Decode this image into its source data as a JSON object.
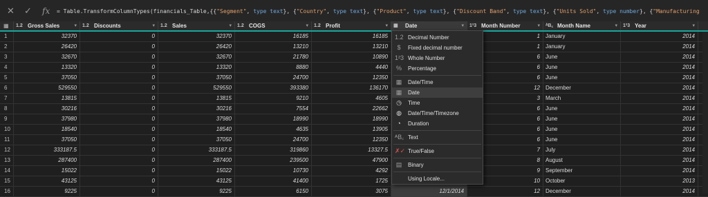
{
  "formula_bar": {
    "formula_segments": [
      {
        "t": "= Table.TransformColumnTypes(financials_Table,{{",
        "c": ""
      },
      {
        "t": "\"Segment\"",
        "c": "s"
      },
      {
        "t": ", ",
        "c": ""
      },
      {
        "t": "type text",
        "c": "t"
      },
      {
        "t": "}, {",
        "c": ""
      },
      {
        "t": "\"Country\"",
        "c": "s"
      },
      {
        "t": ", ",
        "c": ""
      },
      {
        "t": "type text",
        "c": "t"
      },
      {
        "t": "}, {",
        "c": ""
      },
      {
        "t": "\"Product\"",
        "c": "s"
      },
      {
        "t": ", ",
        "c": ""
      },
      {
        "t": "type text",
        "c": "t"
      },
      {
        "t": "}, {",
        "c": ""
      },
      {
        "t": "\"Discount Band\"",
        "c": "s"
      },
      {
        "t": ", ",
        "c": ""
      },
      {
        "t": "type text",
        "c": "t"
      },
      {
        "t": "}, {",
        "c": ""
      },
      {
        "t": "\"Units Sold\"",
        "c": "s"
      },
      {
        "t": ", ",
        "c": ""
      },
      {
        "t": "type number",
        "c": "t"
      },
      {
        "t": "}, {",
        "c": ""
      },
      {
        "t": "\"Manufacturing",
        "c": "s"
      }
    ],
    "icons": {
      "cancel": "close-icon",
      "commit": "check-icon",
      "fx": "fx-icon"
    }
  },
  "columns": [
    {
      "name": "Gross Sales",
      "type_icon": "1.2"
    },
    {
      "name": "Discounts",
      "type_icon": "1.2"
    },
    {
      "name": "Sales",
      "type_icon": "1.2"
    },
    {
      "name": "COGS",
      "type_icon": "1.2"
    },
    {
      "name": "Profit",
      "type_icon": "1.2"
    },
    {
      "name": "Date",
      "type_icon": "▦"
    },
    {
      "name": "Month Number",
      "type_icon": "1²3"
    },
    {
      "name": "Month Name",
      "type_icon": "ᴬB꜀"
    },
    {
      "name": "Year",
      "type_icon": "1²3"
    }
  ],
  "rows": [
    [
      "1",
      "32370",
      "0",
      "32370",
      "16185",
      "16185",
      "",
      "1",
      "January",
      "2014"
    ],
    [
      "2",
      "26420",
      "0",
      "26420",
      "13210",
      "13210",
      "",
      "1",
      "January",
      "2014"
    ],
    [
      "3",
      "32670",
      "0",
      "32670",
      "21780",
      "10890",
      "",
      "6",
      "June",
      "2014"
    ],
    [
      "4",
      "13320",
      "0",
      "13320",
      "8880",
      "4440",
      "",
      "6",
      "June",
      "2014"
    ],
    [
      "5",
      "37050",
      "0",
      "37050",
      "24700",
      "12350",
      "",
      "6",
      "June",
      "2014"
    ],
    [
      "6",
      "529550",
      "0",
      "529550",
      "393380",
      "136170",
      "",
      "12",
      "December",
      "2014"
    ],
    [
      "7",
      "13815",
      "0",
      "13815",
      "9210",
      "4605",
      "",
      "3",
      "March",
      "2014"
    ],
    [
      "8",
      "30216",
      "0",
      "30216",
      "7554",
      "22662",
      "",
      "6",
      "June",
      "2014"
    ],
    [
      "9",
      "37980",
      "0",
      "37980",
      "18990",
      "18990",
      "",
      "6",
      "June",
      "2014"
    ],
    [
      "10",
      "18540",
      "0",
      "18540",
      "4635",
      "13905",
      "",
      "6",
      "June",
      "2014"
    ],
    [
      "11",
      "37050",
      "0",
      "37050",
      "24700",
      "12350",
      "",
      "6",
      "June",
      "2014"
    ],
    [
      "12",
      "333187.5",
      "0",
      "333187.5",
      "319860",
      "13327.5",
      "",
      "7",
      "July",
      "2014"
    ],
    [
      "13",
      "287400",
      "0",
      "287400",
      "239500",
      "47900",
      "",
      "8",
      "August",
      "2014"
    ],
    [
      "14",
      "15022",
      "0",
      "15022",
      "10730",
      "4292",
      "",
      "9",
      "September",
      "2014"
    ],
    [
      "15",
      "43125",
      "0",
      "43125",
      "41400",
      "1725",
      "",
      "10",
      "October",
      "2013"
    ],
    [
      "16",
      "9225",
      "0",
      "9225",
      "6150",
      "3075",
      "12/1/2014",
      "12",
      "December",
      "2014"
    ]
  ],
  "type_menu": {
    "items": [
      {
        "label": "Decimal Number",
        "icon": "1.2",
        "icon_name": "decimal-icon"
      },
      {
        "label": "Fixed decimal number",
        "icon": "$",
        "icon_name": "currency-icon"
      },
      {
        "label": "Whole Number",
        "icon": "1²3",
        "icon_name": "whole-number-icon"
      },
      {
        "label": "Percentage",
        "icon": "%",
        "icon_name": "percent-icon"
      },
      {
        "label": "Date/Time",
        "icon": "▦",
        "icon_name": "datetime-icon",
        "sep_before": true
      },
      {
        "label": "Date",
        "icon": "▦",
        "icon_name": "date-icon",
        "active": true
      },
      {
        "label": "Time",
        "icon": "◷",
        "icon_name": "clock-icon"
      },
      {
        "label": "Date/Time/Timezone",
        "icon": "◍",
        "icon_name": "timezone-icon"
      },
      {
        "label": "Duration",
        "icon": "◔",
        "icon_name": "duration-icon"
      },
      {
        "label": "Text",
        "icon": "ᴬB꜀",
        "icon_name": "text-icon",
        "sep_before": true
      },
      {
        "label": "True/False",
        "icon": "✗✓",
        "icon_name": "boolean-icon",
        "sep_before": true
      },
      {
        "label": "Binary",
        "icon": "▤",
        "icon_name": "binary-icon",
        "sep_before": true
      },
      {
        "label": "Using Locale...",
        "icon": "",
        "icon_name": "",
        "sep_before": true
      }
    ]
  },
  "colors": {
    "accent": "#17a89e",
    "background": "#1f1f1f",
    "header": "#2b2b2b"
  }
}
